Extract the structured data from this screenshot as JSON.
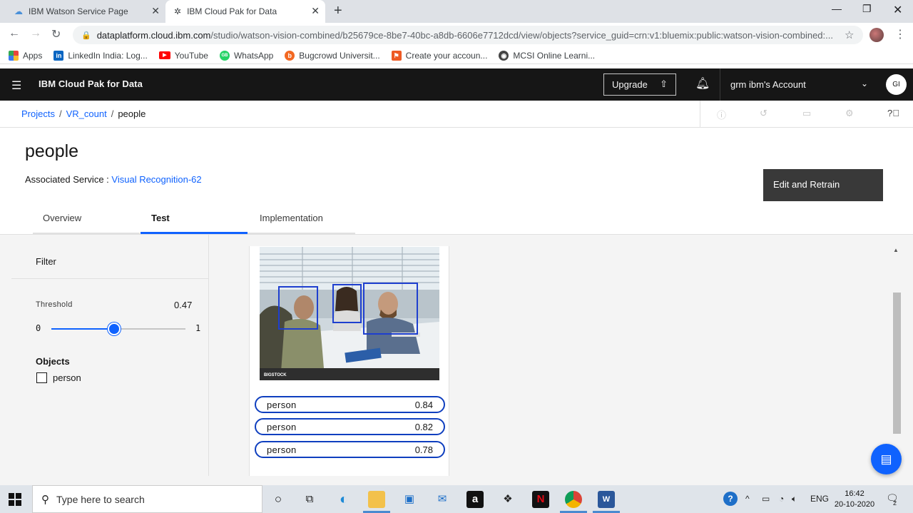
{
  "browser": {
    "tabs": [
      {
        "title": "IBM Watson Service Page"
      },
      {
        "title": "IBM Cloud Pak for Data"
      }
    ],
    "url_host": "dataplatform.cloud.ibm.com",
    "url_rest": "/studio/watson-vision-combined/b25679ce-8be7-40bc-a8db-6606e7712dcd/view/objects?service_guid=crn:v1:bluemix:public:watson-vision-combined:...",
    "bookmarks": [
      {
        "label": "Apps",
        "icon": "apps-grid-icon",
        "color": "#e8453c"
      },
      {
        "label": "LinkedIn India: Log...",
        "icon": "linkedin-icon",
        "color": "#0a66c2"
      },
      {
        "label": "YouTube",
        "icon": "youtube-icon",
        "color": "#ff0000"
      },
      {
        "label": "WhatsApp",
        "icon": "whatsapp-icon",
        "color": "#25d366"
      },
      {
        "label": "Bugcrowd Universit...",
        "icon": "bugcrowd-icon",
        "color": "#f26822"
      },
      {
        "label": "Create your accoun...",
        "icon": "bookmark-icon",
        "color": "#ee5a24"
      },
      {
        "label": "MCSI Online Learni...",
        "icon": "mcsi-icon",
        "color": "#444444"
      }
    ]
  },
  "header": {
    "brand": "IBM Cloud Pak for Data",
    "upgrade_label": "Upgrade",
    "account_label": "grm ibm's Account",
    "avatar_initials": "GI"
  },
  "breadcrumb": {
    "items": [
      "Projects",
      "VR_count"
    ],
    "current": "people"
  },
  "page": {
    "title": "people",
    "assoc_label": "Associated Service :",
    "assoc_link": "Visual Recognition-62",
    "edit_button": "Edit and Retrain",
    "tabs": [
      "Overview",
      "Test",
      "Implementation"
    ],
    "active_tab": "Test"
  },
  "filter": {
    "title": "Filter",
    "threshold_label": "Threshold",
    "threshold_value": "0.47",
    "threshold_fraction": 0.47,
    "min_label": "0",
    "max_label": "1",
    "objects_title": "Objects",
    "objects": [
      {
        "label": "person",
        "checked": false
      }
    ]
  },
  "result": {
    "image_watermark": "BIGSTOCK",
    "detections": [
      {
        "label": "person",
        "score": "0.84"
      },
      {
        "label": "person",
        "score": "0.82"
      },
      {
        "label": "person",
        "score": "0.78"
      }
    ]
  },
  "taskbar": {
    "search_placeholder": "Type here to search",
    "language": "ENG",
    "time": "16:42",
    "date": "20-10-2020",
    "notification_count": "2"
  },
  "colors": {
    "accent": "#0f62fe",
    "header_bg": "#161616",
    "detection_border": "#0f3fbf"
  }
}
